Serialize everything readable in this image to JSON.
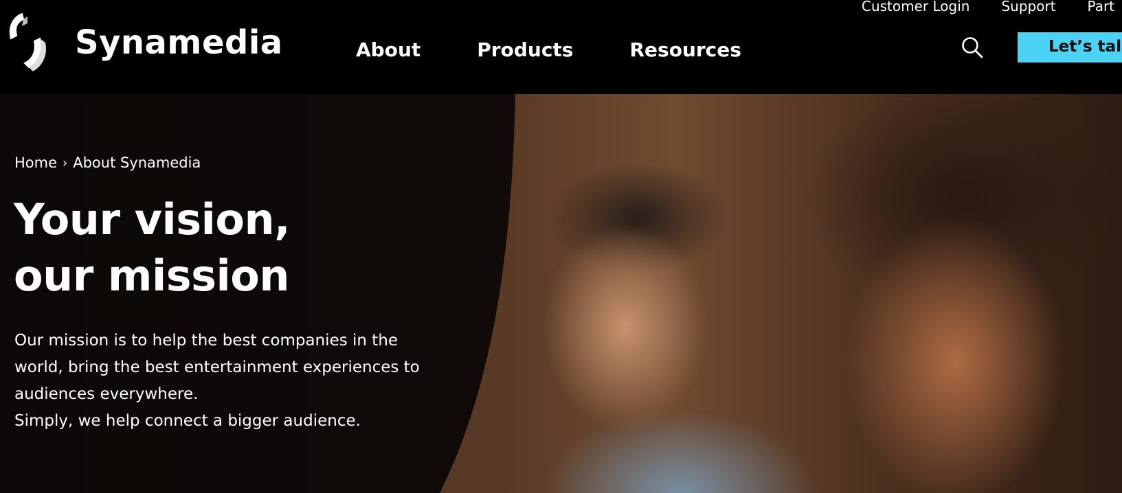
{
  "header": {
    "brand": "Synamedia",
    "utility_links": [
      "Customer Login",
      "Support",
      "Part"
    ],
    "nav": [
      "About",
      "Products",
      "Resources"
    ],
    "cta_label": "Let’s talk",
    "search_icon": "search-icon",
    "accent_color": "#4cd2f5"
  },
  "hero": {
    "breadcrumb": {
      "home": "Home",
      "separator": "›",
      "current": "About Synamedia"
    },
    "title_line1": "Your vision,",
    "title_line2": "our mission",
    "description_lines": [
      "Our mission is to help the best companies in the",
      "world, bring the best entertainment experiences to",
      "audiences everywhere.",
      "Simply, we help connect a bigger audience."
    ]
  }
}
